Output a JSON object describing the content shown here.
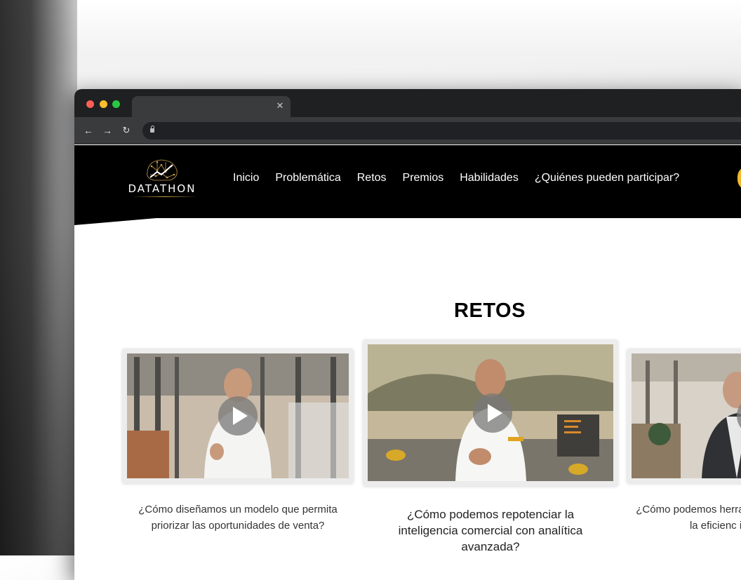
{
  "site": {
    "logo_text": "DATATHON",
    "nav": [
      "Inicio",
      "Problemática",
      "Retos",
      "Premios",
      "Habilidades",
      "¿Quiénes pueden participar?"
    ]
  },
  "section": {
    "title": "RETOS"
  },
  "cards": [
    {
      "caption": "¿Cómo diseñamos un modelo que permita priorizar las oportunidades de venta?"
    },
    {
      "caption": "¿Cómo podemos repotenciar la inteligencia comercial con analítica avanzada?"
    },
    {
      "caption": "¿Cómo podemos herramientas de Ma impulsar la eficienc insights a par"
    }
  ],
  "colors": {
    "header_bg": "#000000",
    "accent": "#c9a04a",
    "cta": "#f5b82e"
  },
  "icons": [
    "lock-icon",
    "back-arrow-icon",
    "forward-arrow-icon",
    "reload-icon",
    "close-icon",
    "play-icon",
    "datathon-brain-logo"
  ]
}
